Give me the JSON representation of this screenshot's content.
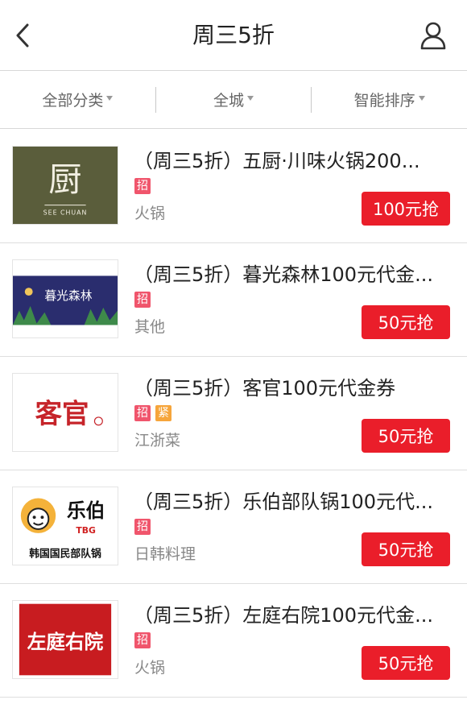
{
  "header": {
    "title": "周三5折"
  },
  "filters": [
    {
      "label": "全部分类"
    },
    {
      "label": "全城"
    },
    {
      "label": "智能排序"
    }
  ],
  "deals": [
    {
      "title": "（周三5折）五厨·川味火锅200...",
      "tags": [
        "招"
      ],
      "category": "火锅",
      "button": "100元抢",
      "logo_text": "厨",
      "logo_sub": "SEE CHUAN"
    },
    {
      "title": "（周三5折）暮光森林100元代金...",
      "tags": [
        "招"
      ],
      "category": "其他",
      "button": "50元抢",
      "logo_text": "暮光森林"
    },
    {
      "title": "（周三5折）客官100元代金券",
      "tags": [
        "招",
        "紧"
      ],
      "category": "江浙菜",
      "button": "50元抢",
      "logo_text": "客官"
    },
    {
      "title": "（周三5折）乐伯部队锅100元代...",
      "tags": [
        "招"
      ],
      "category": "日韩料理",
      "button": "50元抢",
      "logo_text": "乐伯",
      "logo_sub": "韩国国民部队锅"
    },
    {
      "title": "（周三5折）左庭右院100元代金...",
      "tags": [
        "招"
      ],
      "category": "火锅",
      "button": "50元抢",
      "logo_text": "左庭右院"
    }
  ]
}
